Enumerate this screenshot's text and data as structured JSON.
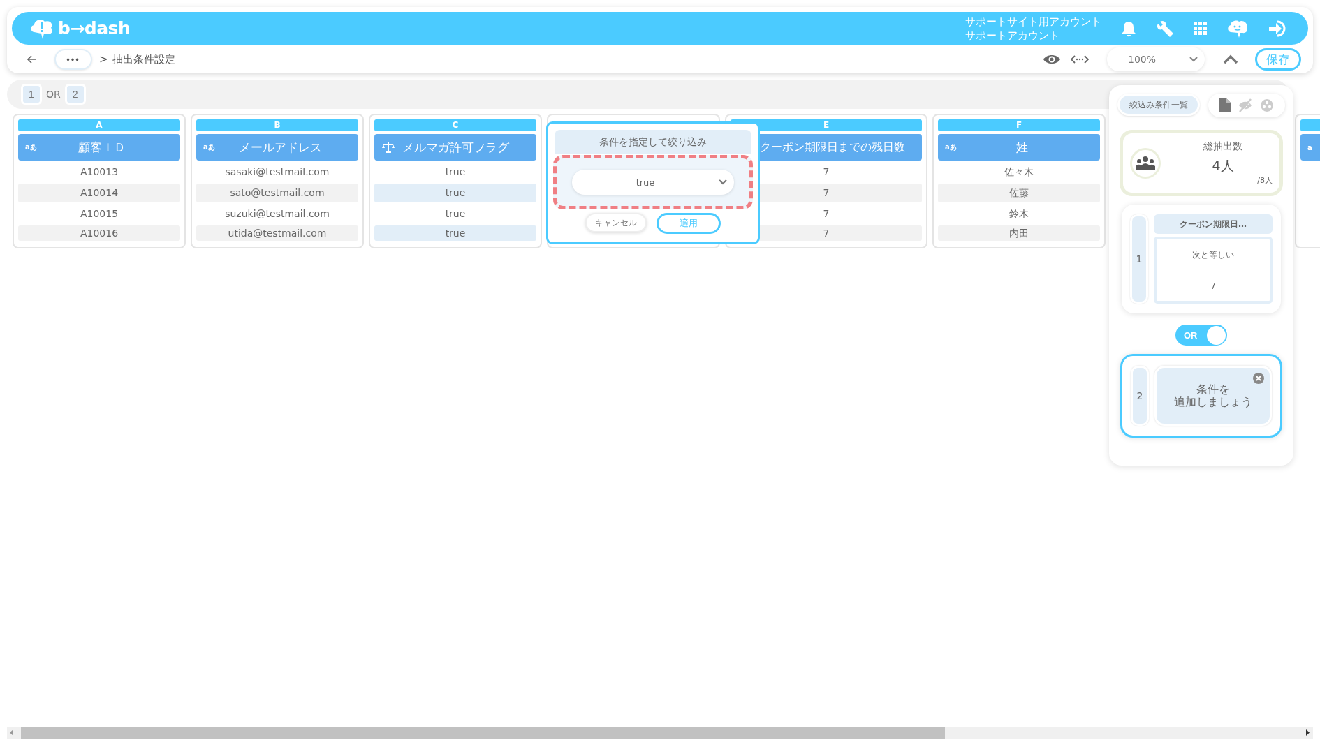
{
  "header": {
    "logo": "b→dash",
    "account_lines": [
      "サポートサイト用アカウント",
      "サポートアカウント"
    ]
  },
  "breadcrumb": {
    "more": "•••",
    "separator": ">",
    "current": "抽出条件設定"
  },
  "zoom": {
    "value": "100%"
  },
  "save_button": "保存",
  "group_tabs": [
    {
      "kind": "group",
      "label": "1"
    },
    {
      "kind": "operator",
      "label": "OR"
    },
    {
      "kind": "group",
      "label": "2"
    }
  ],
  "columns": [
    {
      "covered": false,
      "selected": false,
      "letter": "A",
      "kind": "text",
      "type_label": "aあ",
      "title": "顧客ＩＤ",
      "cells": [
        "A10013",
        "A10014",
        "A10015",
        "A10016"
      ]
    },
    {
      "covered": false,
      "selected": false,
      "letter": "B",
      "kind": "text",
      "type_label": "aあ",
      "title": "メールアドレス",
      "cells": [
        "sasaki@testmail.com",
        "sato@testmail.com",
        "suzuki@testmail.com",
        "utida@testmail.com"
      ]
    },
    {
      "covered": false,
      "selected": true,
      "letter": "C",
      "kind": "boolean",
      "title": "メルマガ許可フラグ",
      "cells": [
        "true",
        "true",
        "true",
        "true"
      ]
    },
    {
      "covered": true
    },
    {
      "covered": false,
      "selected": false,
      "letter": "E",
      "kind": "number",
      "title": "クーポン期限日までの残日数",
      "cells": [
        "7",
        "7",
        "7",
        "7"
      ]
    },
    {
      "covered": false,
      "selected": false,
      "letter": "F",
      "kind": "text",
      "type_label": "aあ",
      "title": "姓",
      "cells": [
        "佐々木",
        "佐藤",
        "鈴木",
        "内田"
      ]
    },
    {
      "partial": true,
      "kind": "text",
      "type_label": "a"
    }
  ],
  "popup": {
    "title": "条件を指定して絞り込み",
    "value": "true",
    "cancel": "キャンセル",
    "apply": "適用"
  },
  "panel": {
    "list_button": "絞込み条件一覧",
    "total_label": "総抽出数",
    "total": "4人",
    "total_of": "/8人",
    "conditions": [
      {
        "kind": "condition",
        "number": "1",
        "field": "クーポン期限日…",
        "operator": "次と等しい",
        "value": "7",
        "selected": false
      },
      {
        "kind": "toggle",
        "label": "OR",
        "on": true
      },
      {
        "kind": "empty",
        "number": "2",
        "prompt_lines": [
          "条件を",
          "追加しましょう"
        ],
        "selected": true
      }
    ]
  }
}
